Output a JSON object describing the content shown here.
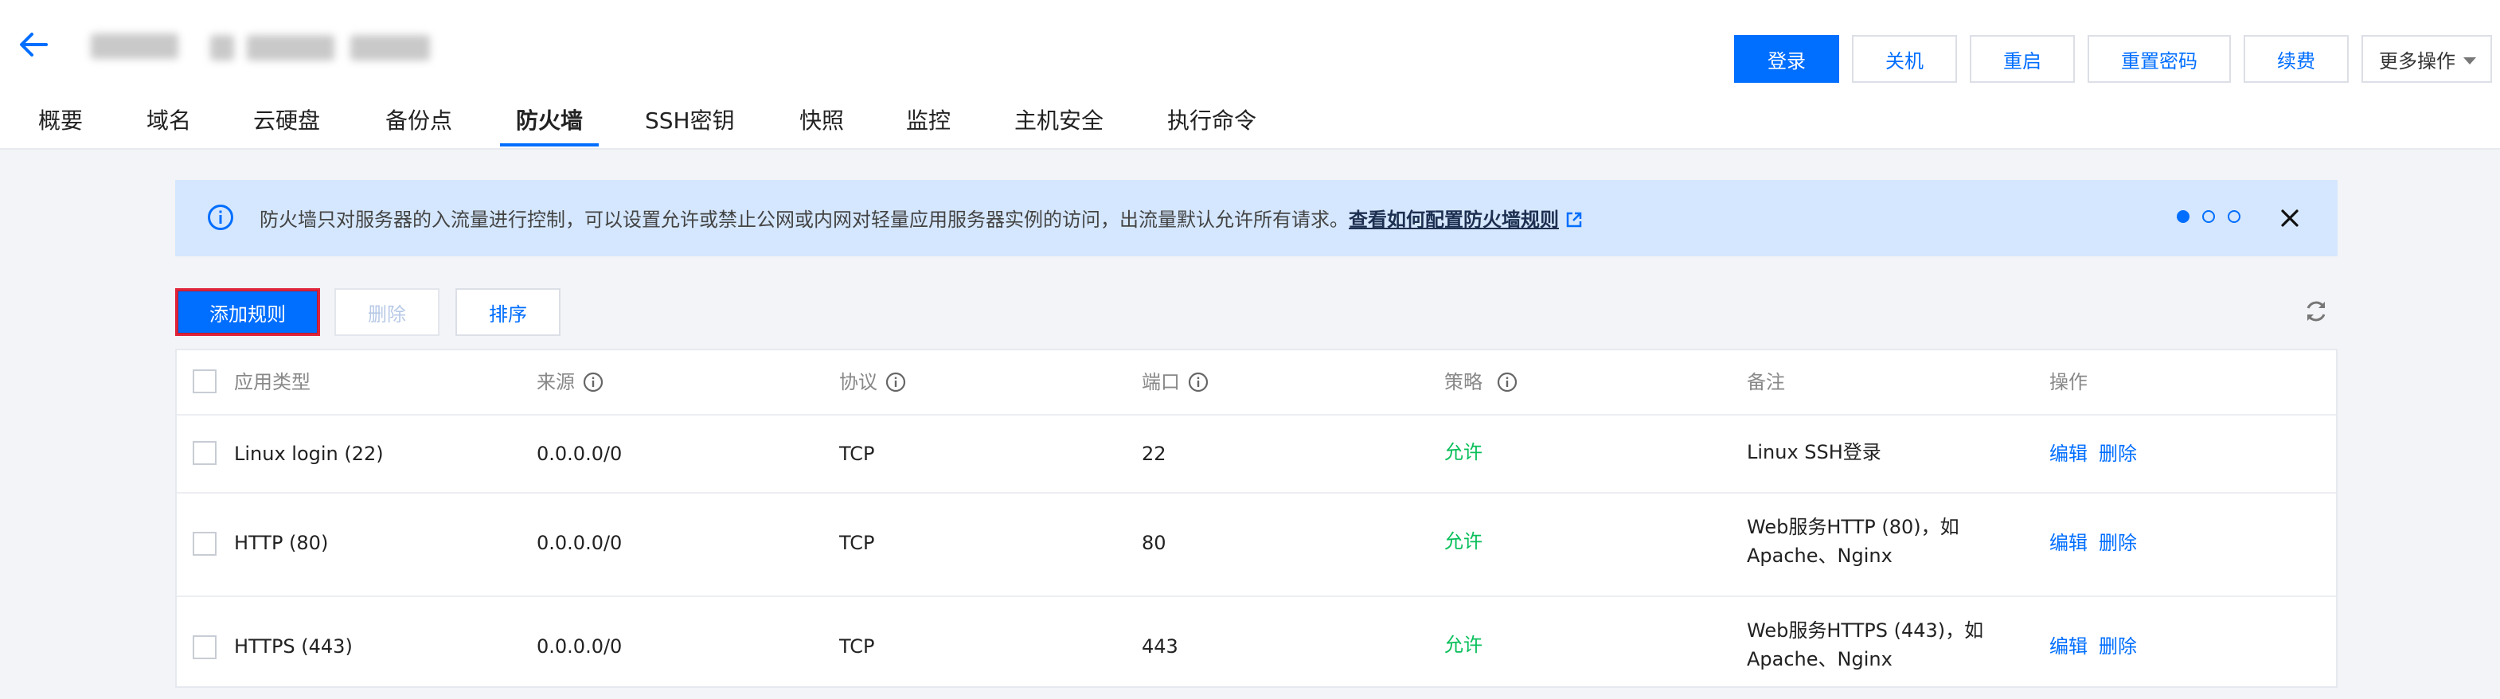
{
  "header": {
    "buttons": {
      "login": "登录",
      "shutdown": "关机",
      "restart": "重启",
      "reset_password": "重置密码",
      "renew": "续费",
      "more": "更多操作"
    },
    "tabs": [
      {
        "label": "概要"
      },
      {
        "label": "域名"
      },
      {
        "label": "云硬盘"
      },
      {
        "label": "备份点"
      },
      {
        "label": "防火墙"
      },
      {
        "label": "SSH密钥"
      },
      {
        "label": "快照"
      },
      {
        "label": "监控"
      },
      {
        "label": "主机安全"
      },
      {
        "label": "执行命令"
      }
    ]
  },
  "notice": {
    "text": "防火墙只对服务器的入流量进行控制，可以设置允许或禁止公网或内网对轻量应用服务器实例的访问，出流量默认允许所有请求。",
    "link": "查看如何配置防火墙规则"
  },
  "toolbar": {
    "add": "添加规则",
    "delete": "删除",
    "sort": "排序"
  },
  "table": {
    "headers": {
      "app_type": "应用类型",
      "source": "来源",
      "protocol": "协议",
      "port": "端口",
      "policy": "策略",
      "remark": "备注",
      "operation": "操作"
    },
    "rows": [
      {
        "app": "Linux login (22)",
        "source": "0.0.0.0/0",
        "protocol": "TCP",
        "port": "22",
        "policy": "允许",
        "remark1": "Linux SSH登录",
        "remark2": "",
        "edit": "编辑",
        "delete": "删除"
      },
      {
        "app": "HTTP (80)",
        "source": "0.0.0.0/0",
        "protocol": "TCP",
        "port": "80",
        "policy": "允许",
        "remark1": "Web服务HTTP (80)，如",
        "remark2": "Apache、Nginx",
        "edit": "编辑",
        "delete": "删除"
      },
      {
        "app": "HTTPS (443)",
        "source": "0.0.0.0/0",
        "protocol": "TCP",
        "port": "443",
        "policy": "允许",
        "remark1": "Web服务HTTPS (443)，如",
        "remark2": "Apache、Nginx",
        "edit": "编辑",
        "delete": "删除"
      }
    ]
  },
  "colors": {
    "primary": "#006eff",
    "allow": "#0abf5b",
    "notice_bg": "#d5e7fe",
    "highlight_border": "#e0243b"
  }
}
